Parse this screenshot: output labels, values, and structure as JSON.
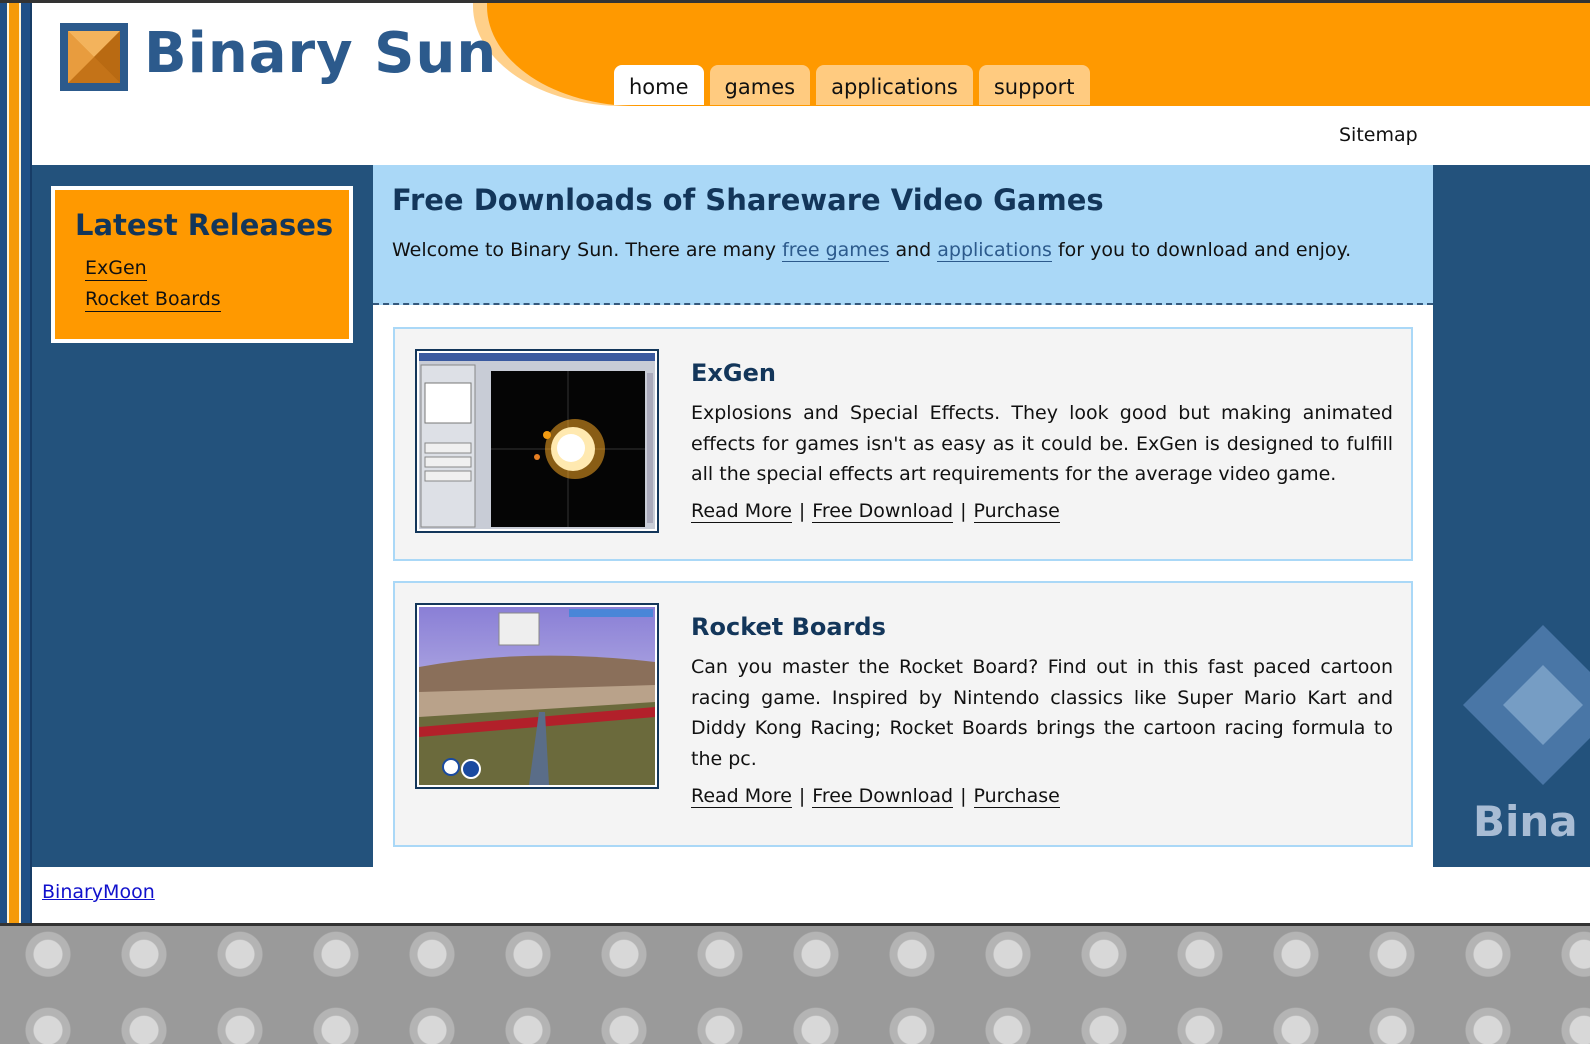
{
  "site": {
    "logo_text": "Binary Sun",
    "brand_colors": {
      "orange": "#ff9900",
      "navy": "#23527c",
      "light_blue": "#aad8f7"
    }
  },
  "nav": {
    "tabs": [
      {
        "label": "home",
        "active": true
      },
      {
        "label": "games",
        "active": false
      },
      {
        "label": "applications",
        "active": false
      },
      {
        "label": "support",
        "active": false
      }
    ],
    "sitemap_label": "Sitemap"
  },
  "sidebar": {
    "title": "Latest Releases",
    "links": [
      "ExGen",
      "Rocket Boards"
    ]
  },
  "intro": {
    "title": "Free Downloads of Shareware Video Games",
    "text_before": "Welcome to Binary Sun. There are many ",
    "link1": "free games",
    "text_mid": " and ",
    "link2": "applications",
    "text_after": " for you to download and enjoy."
  },
  "products": [
    {
      "title": "ExGen",
      "description": "Explosions and Special Effects. They look good but making animated effects for games isn't as easy as it could be. ExGen is designed to fulfill all the special effects art requirements for the average video game.",
      "links": [
        "Read More",
        "Free Download",
        "Purchase"
      ]
    },
    {
      "title": "Rocket Boards",
      "description": "Can you master the Rocket Board? Find out in this fast paced cartoon racing game. Inspired by Nintendo classics like Super Mario Kart and Diddy Kong Racing; Rocket Boards brings the cartoon racing formula to the pc.",
      "links": [
        "Read More",
        "Free Download",
        "Purchase"
      ]
    }
  ],
  "separator": "|",
  "deco_text": "Bina",
  "footer": {
    "link": "BinaryMoon"
  }
}
